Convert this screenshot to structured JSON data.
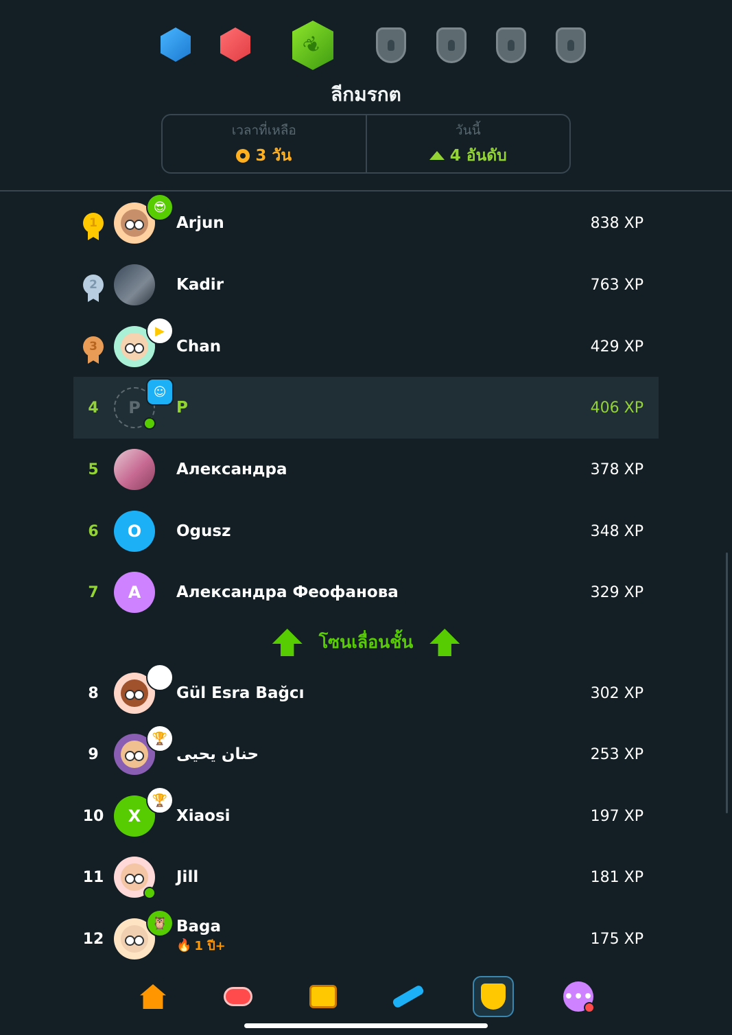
{
  "league": {
    "title": "ลีกมรกต",
    "time_left_label": "เวลาที่เหลือ",
    "time_left_value": "3 วัน",
    "today_label": "วันนี้",
    "today_value": "4 อันดับ"
  },
  "leaderboard": [
    {
      "rank": "1",
      "name": "Arjun",
      "xp": "838 XP",
      "avatar_letter": ""
    },
    {
      "rank": "2",
      "name": "Kadir",
      "xp": "763 XP",
      "avatar_letter": ""
    },
    {
      "rank": "3",
      "name": "Chan",
      "xp": "429 XP",
      "avatar_letter": ""
    },
    {
      "rank": "4",
      "name": "P",
      "xp": "406 XP",
      "avatar_letter": "P"
    },
    {
      "rank": "5",
      "name": "Александра",
      "xp": "378 XP",
      "avatar_letter": ""
    },
    {
      "rank": "6",
      "name": "Ogusz",
      "xp": "348 XP",
      "avatar_letter": "O"
    },
    {
      "rank": "7",
      "name": "Александра Феофанова",
      "xp": "329 XP",
      "avatar_letter": "A"
    },
    {
      "rank": "8",
      "name": "Gül Esra Bağcı",
      "xp": "302 XP",
      "avatar_letter": ""
    },
    {
      "rank": "9",
      "name": "حنان يحيى",
      "xp": "253 XP",
      "avatar_letter": ""
    },
    {
      "rank": "10",
      "name": "Xiaosi",
      "xp": "197 XP",
      "avatar_letter": "X"
    },
    {
      "rank": "11",
      "name": "Jill",
      "xp": "181 XP",
      "avatar_letter": ""
    },
    {
      "rank": "12",
      "name": "Baga",
      "xp": "175 XP",
      "avatar_letter": "",
      "streak": "1 ปี+"
    }
  ],
  "promotion_zone_label": "โซนเลื่อนชั้น",
  "colors": {
    "background": "#131f24",
    "accent_green": "#93d333",
    "orange": "#ffb020",
    "current_user_row": "#202f36"
  },
  "tabs": [
    "home-icon",
    "speak-icon",
    "chest-icon",
    "practice-icon",
    "league-icon",
    "more-icon"
  ]
}
